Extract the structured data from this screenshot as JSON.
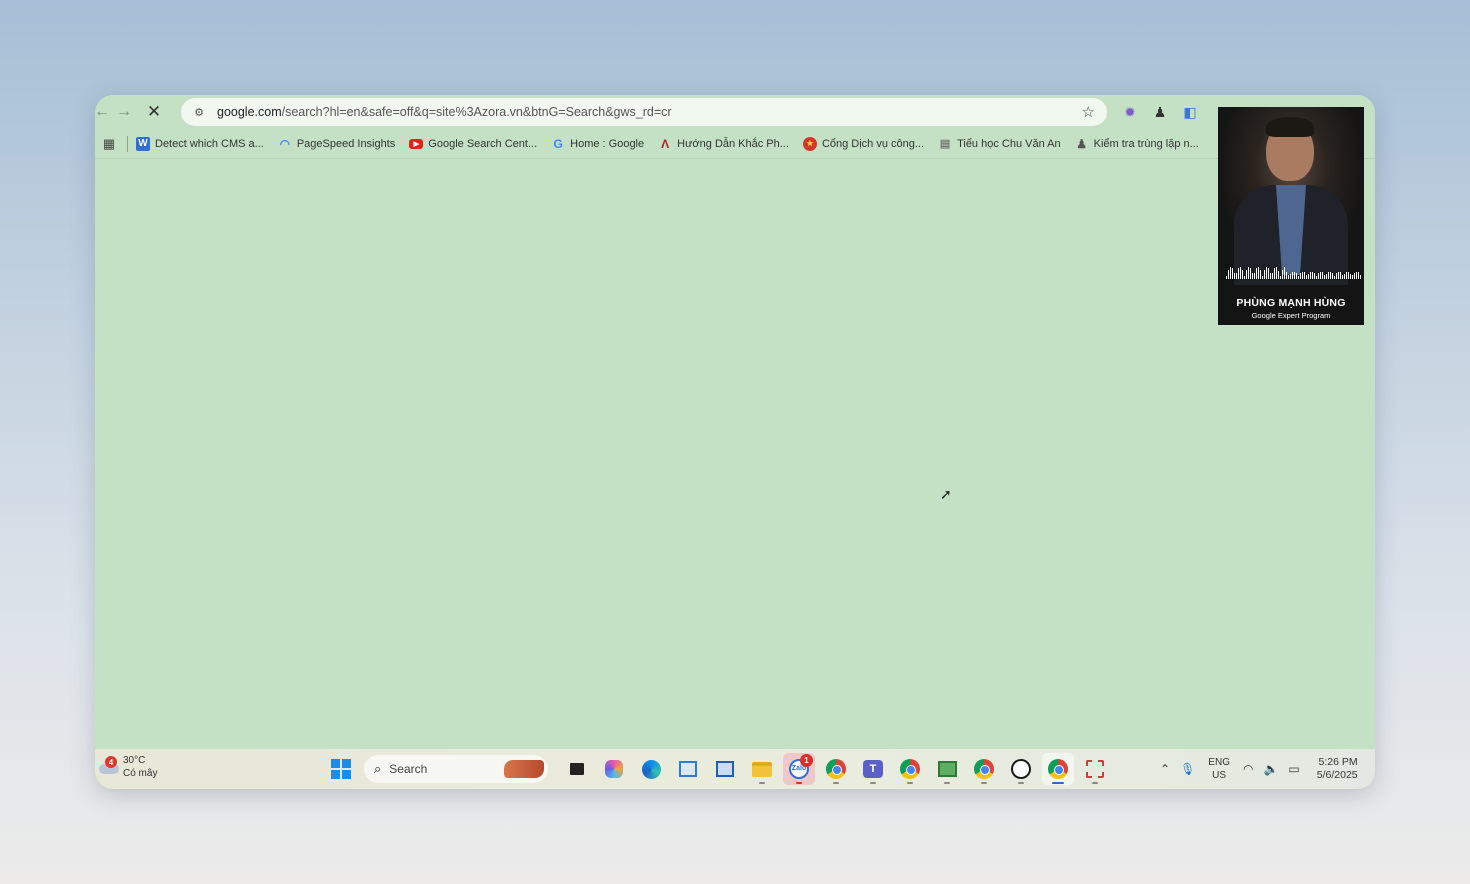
{
  "browser": {
    "url_host": "google.com",
    "url_rest": "/search?hl=en&safe=off&q=site%3Azora.vn&btnG=Search&gws_rd=cr"
  },
  "bookmarks": [
    {
      "label": "Detect which CMS a...",
      "icon": "w-icon",
      "color": "#2f6fd6"
    },
    {
      "label": "PageSpeed Insights",
      "icon": "pagespeed-icon",
      "color": "#4285f4"
    },
    {
      "label": "Google Search Cent...",
      "icon": "youtube-icon",
      "color": "#e62117"
    },
    {
      "label": "Home : Google",
      "icon": "google-icon",
      "color": "#4285f4"
    },
    {
      "label": "Hướng Dẫn Khắc Ph...",
      "icon": "a-logo-icon",
      "color": "#b0202a"
    },
    {
      "label": "Cổng Dịch vụ công...",
      "icon": "emblem-icon",
      "color": "#d8352a"
    },
    {
      "label": "Tiểu học Chu Văn An",
      "icon": "school-icon",
      "color": "#777777"
    },
    {
      "label": "Kiểm tra trùng lặp n...",
      "icon": "person-icon",
      "color": "#555555"
    }
  ],
  "pip": {
    "name": "PHÙNG MẠNH HÙNG",
    "subtitle": "Google Expert Program"
  },
  "taskbar": {
    "weather_badge": "4",
    "temperature": "30°C",
    "weather_desc": "Có mây",
    "search_label": "Search",
    "notif_count": "1",
    "lang_top": "ENG",
    "lang_bottom": "US",
    "time": "5:26 PM",
    "date": "5/6/2025"
  },
  "colors": {
    "page_bg": "#c5e1c5",
    "accent": "#1a6fd0"
  }
}
